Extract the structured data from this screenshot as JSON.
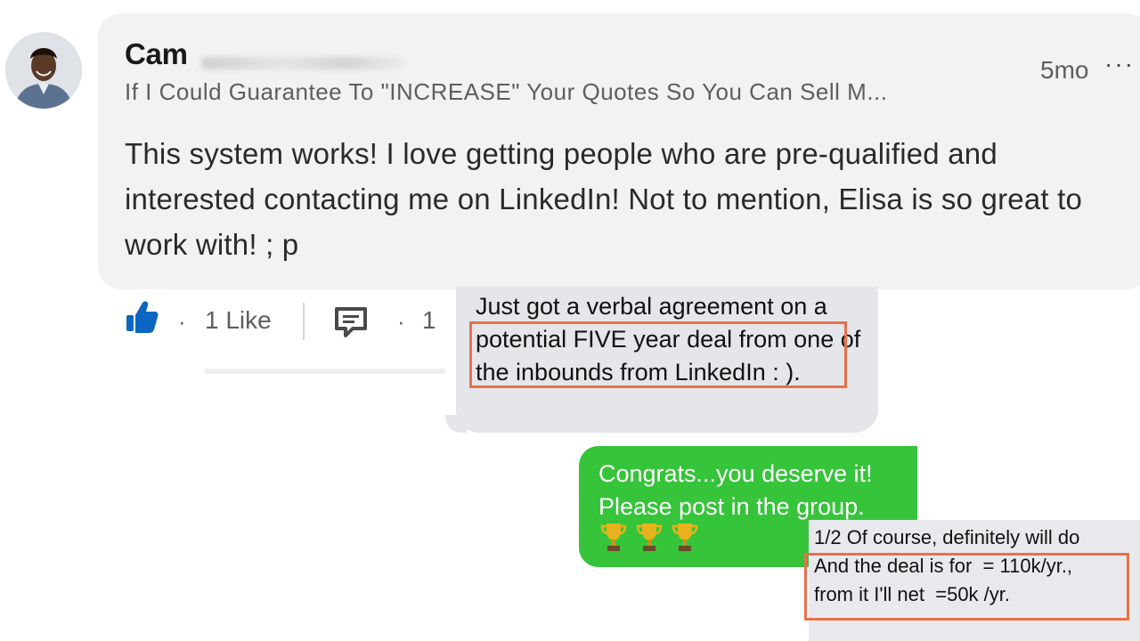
{
  "comment": {
    "author": "Cam",
    "headline": "If I Could Guarantee To \"INCREASE\" Your Quotes So You Can Sell M...",
    "time": "5mo",
    "more_label": "···",
    "body": "This system works! I love getting people who are pre-qualified and interested contacting me on LinkedIn! Not to mention, Elisa is so great to work with! ; p",
    "actions": {
      "like_dot": "·",
      "like_label": "1 Like",
      "comment_dot": "·",
      "comment_count": "1"
    },
    "colors": {
      "card_bg": "#f2f2f2",
      "like_icon": "#0a66c2"
    }
  },
  "messages": {
    "incoming_1": "Just got a verbal agreement on a potential FIVE year deal from one of the inbounds from LinkedIn :  ).",
    "outgoing_1": "Congrats...you deserve it! Please post in the group.",
    "outgoing_emoji": "trophy-icon x3",
    "incoming_2_line1": "1/2 Of course, definitely will do",
    "incoming_2_line2": "And the deal is for  = 110k/yr.,",
    "incoming_2_line3": "from it I'll net  =50k /yr.",
    "colors": {
      "incoming_bg": "#e5e5ea",
      "outgoing_bg": "#36c43a",
      "highlight": "#e8704a"
    }
  }
}
